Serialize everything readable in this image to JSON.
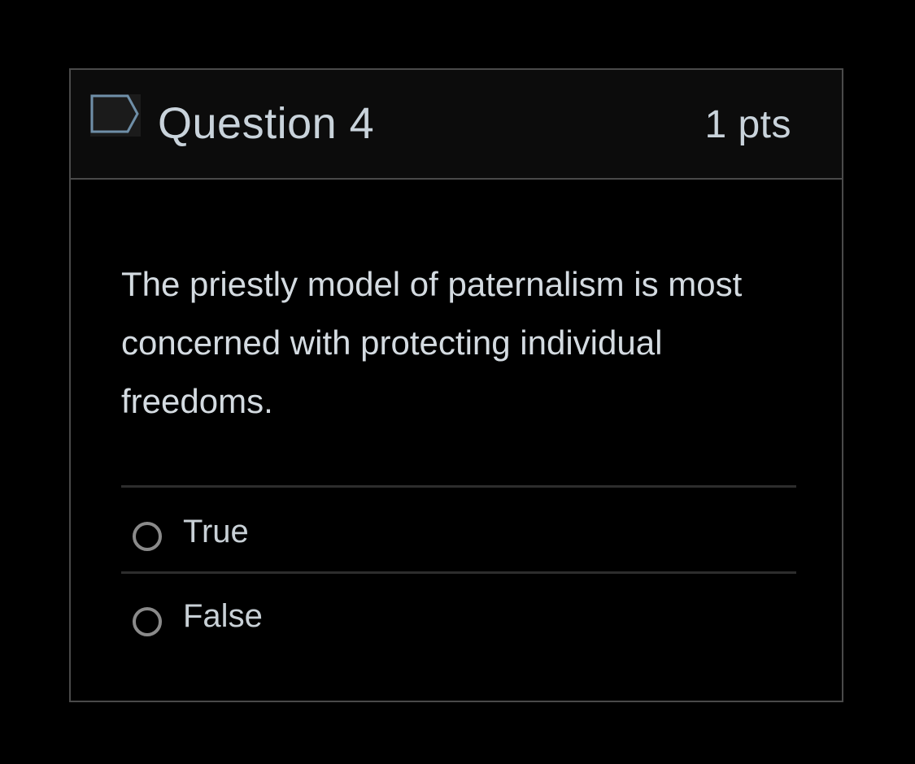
{
  "question": {
    "title": "Question 4",
    "points": "1 pts",
    "flag_icon": "flag-outline-icon",
    "text": "The priestly model of paternalism is most concerned with protecting individual freedoms.",
    "answers": [
      {
        "label": "True",
        "selected": false
      },
      {
        "label": "False",
        "selected": false
      }
    ]
  },
  "colors": {
    "background": "#000000",
    "header_background": "#0c0c0c",
    "border": "#4a4a4a",
    "flag_stroke": "#6f8fa8",
    "text": "#d4dbe1",
    "radio_border": "#8a8a8a"
  }
}
